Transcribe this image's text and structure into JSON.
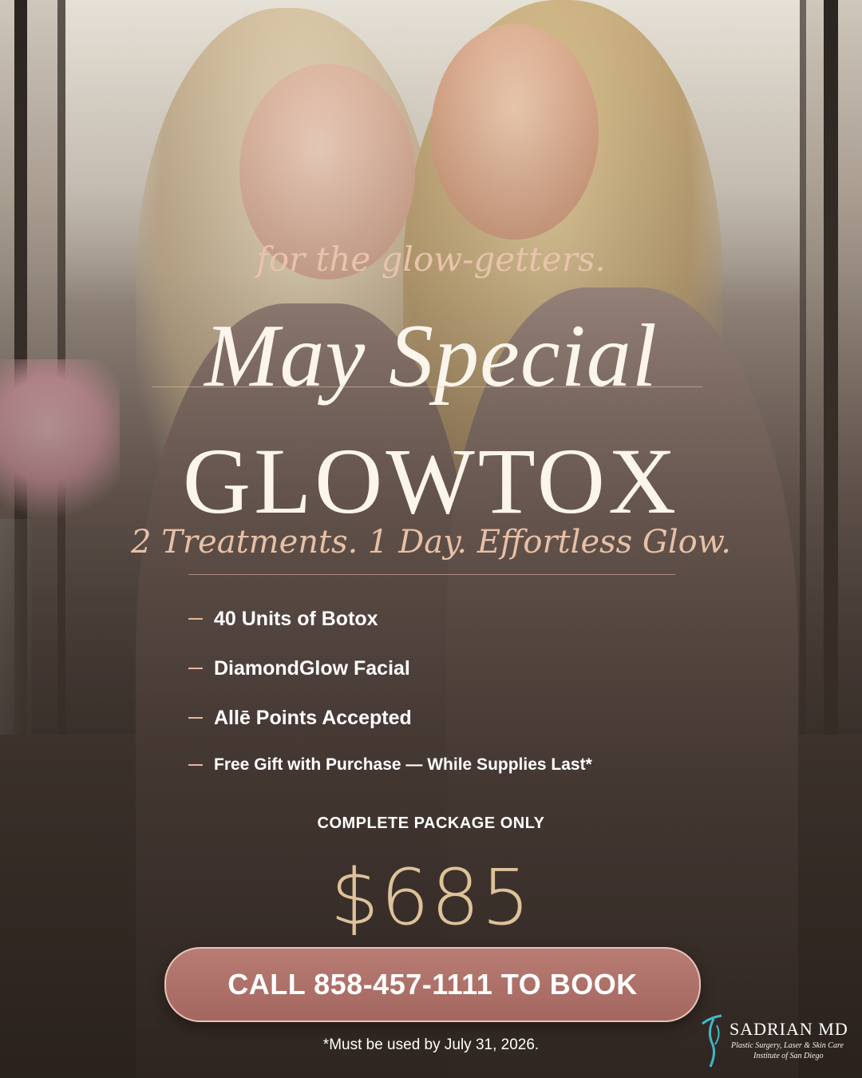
{
  "tagline": "for the glow-getters.",
  "title": "May Special",
  "product": "GLOWTOX",
  "subtitle": "2 Treatments. 1 Day. Effortless Glow.",
  "features": [
    "40 Units of Botox",
    "DiamondGlow Facial",
    "Allē Points Accepted",
    "Free Gift with Purchase — While Supplies Last*"
  ],
  "package_label": "COMPLETE PACKAGE ONLY",
  "price": "$685",
  "cta": "CALL 858-457-1111 TO BOOK",
  "disclaimer": "*Must be used by July 31, 2026.",
  "logo": {
    "name": "SADRIAN MD",
    "line1": "Plastic Surgery, Laser & Skin Care",
    "line2": "Institute of San Diego",
    "icon": "body-silhouette-icon"
  },
  "colors": {
    "accent": "#e9c2ab",
    "cta_bg": "#b07068",
    "price": "#ddc29a",
    "logo_icon": "#3fb9c6"
  }
}
